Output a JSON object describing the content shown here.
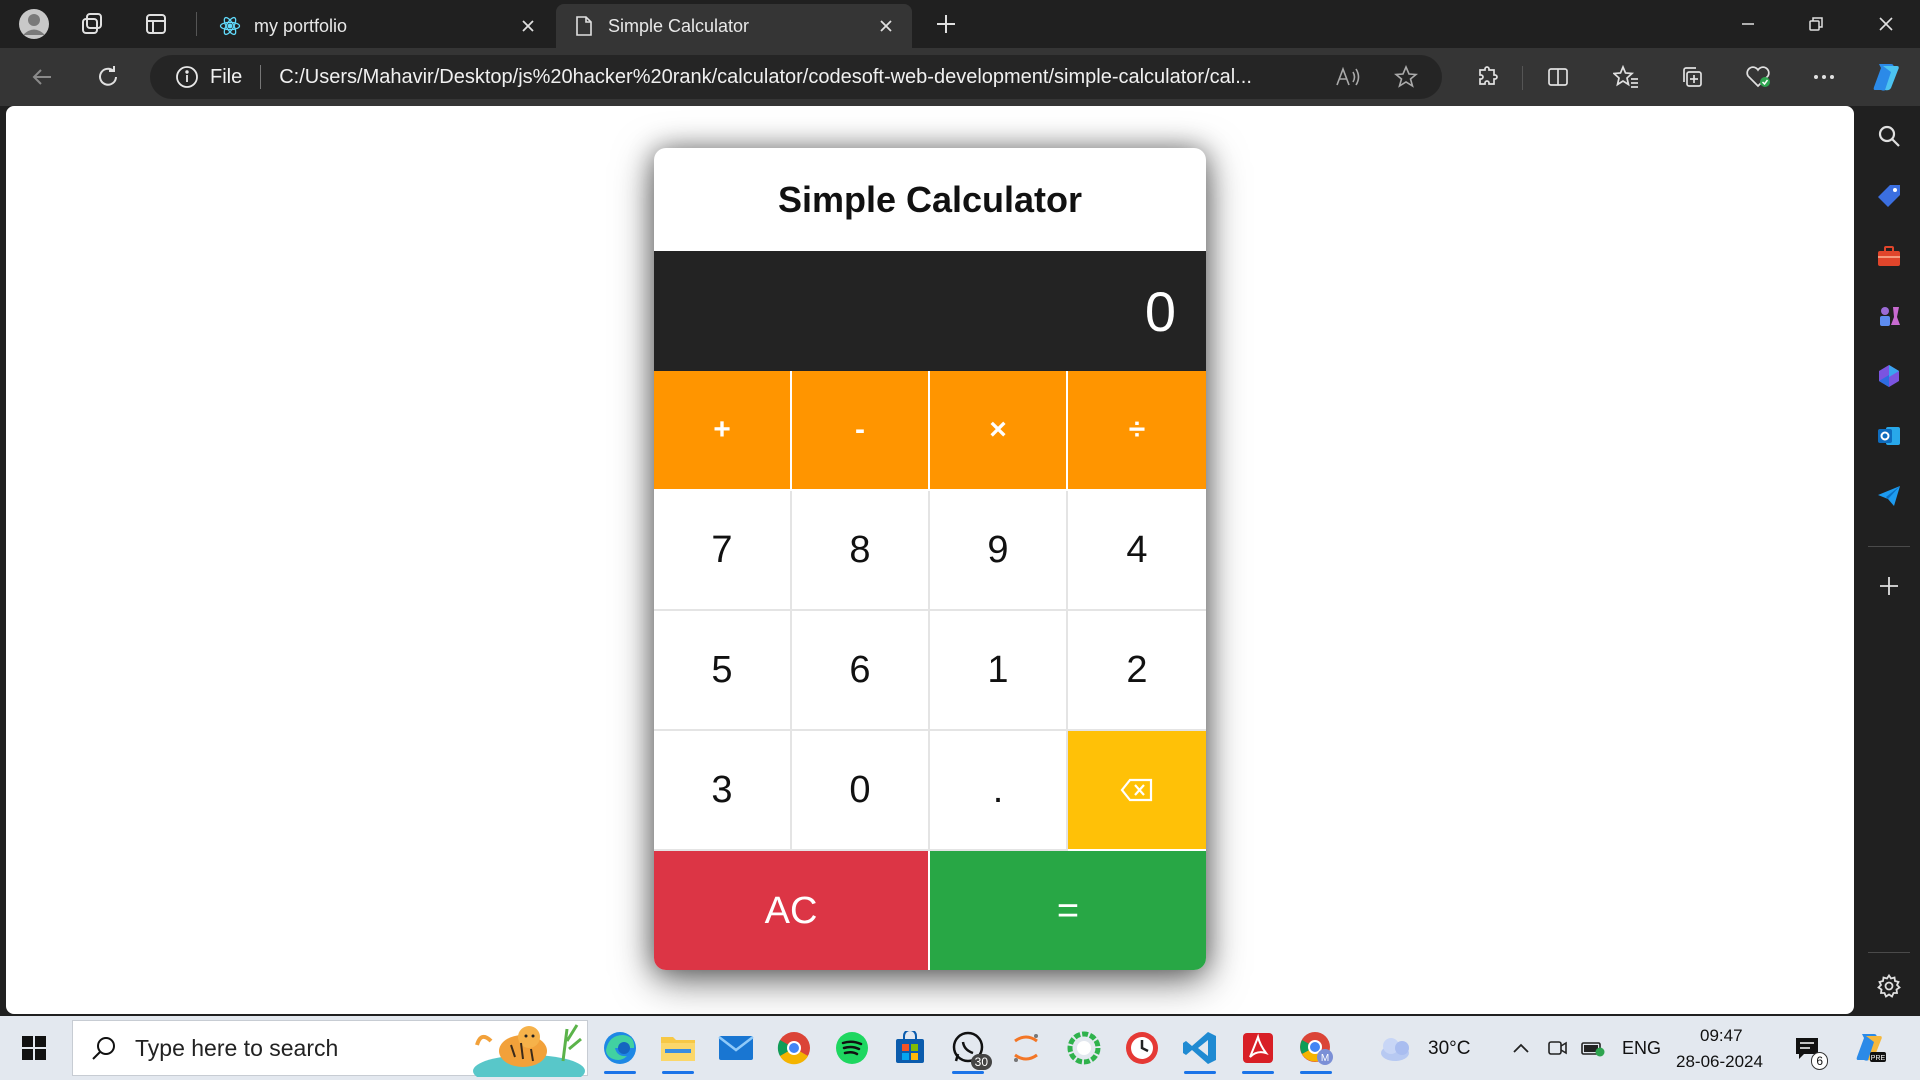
{
  "browser": {
    "tabs": [
      {
        "title": "my portfolio",
        "icon": "react-icon",
        "active": false
      },
      {
        "title": "Simple Calculator",
        "icon": "page-icon",
        "active": true
      }
    ],
    "address": {
      "scheme_label": "File",
      "url": "C:/Users/Mahavir/Desktop/js%20hacker%20rank/calculator/codesoft-web-development/simple-calculator/cal..."
    }
  },
  "calculator": {
    "title": "Simple Calculator",
    "display": "0",
    "operators": [
      "+",
      "-",
      "×",
      "÷"
    ],
    "row1": [
      "7",
      "8",
      "9",
      "4"
    ],
    "row2": [
      "5",
      "6",
      "1",
      "2"
    ],
    "row3": [
      "3",
      "0",
      "."
    ],
    "backspace_icon": "backspace-icon",
    "clear_label": "AC",
    "equals_label": "=",
    "colors": {
      "operator": "#ff9500",
      "backspace": "#ffc107",
      "clear": "#dc3545",
      "equals": "#28a745",
      "display_bg": "#232323"
    }
  },
  "taskbar": {
    "search_placeholder": "Type here to search",
    "whatsapp_badge": "30",
    "weather": "30°C",
    "language": "ENG",
    "time": "09:47",
    "date": "28-06-2024",
    "notifications": "6"
  }
}
